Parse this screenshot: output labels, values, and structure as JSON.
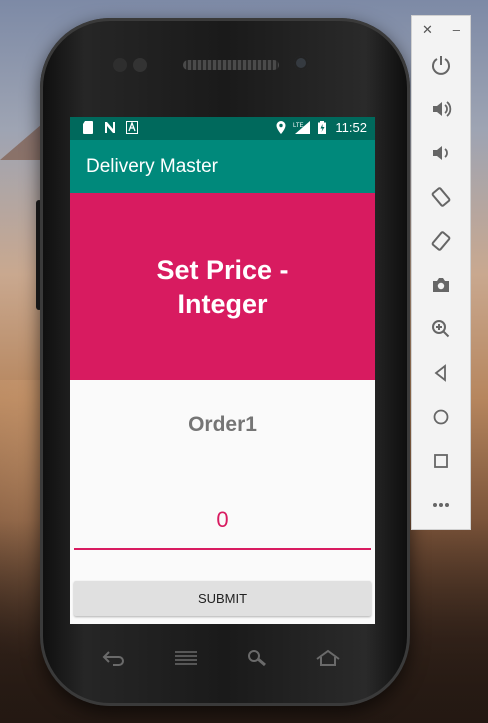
{
  "app": {
    "title": "Delivery Master"
  },
  "status_bar": {
    "time": "11:52",
    "network": "LTE",
    "icons": [
      "sd-card-icon",
      "n-notification-icon",
      "a-notification-icon",
      "location-icon",
      "signal-icon",
      "battery-icon"
    ]
  },
  "hero": {
    "title": "Set Price - Integer"
  },
  "order": {
    "label": "Order1"
  },
  "price_input": {
    "value": "0"
  },
  "submit_button": {
    "label": "SUBMIT"
  },
  "emulator_toolbar": {
    "window_controls": [
      "close-icon",
      "minimize-icon"
    ],
    "buttons": [
      "power-icon",
      "volume-up-icon",
      "volume-down-icon",
      "rotate-left-icon",
      "rotate-right-icon",
      "camera-icon",
      "zoom-icon",
      "back-icon",
      "home-icon",
      "overview-icon",
      "more-icon"
    ]
  },
  "colors": {
    "primary_dark": "#00695c",
    "primary": "#00897b",
    "accent": "#d81b60",
    "hero_bg": "#d81b60"
  }
}
